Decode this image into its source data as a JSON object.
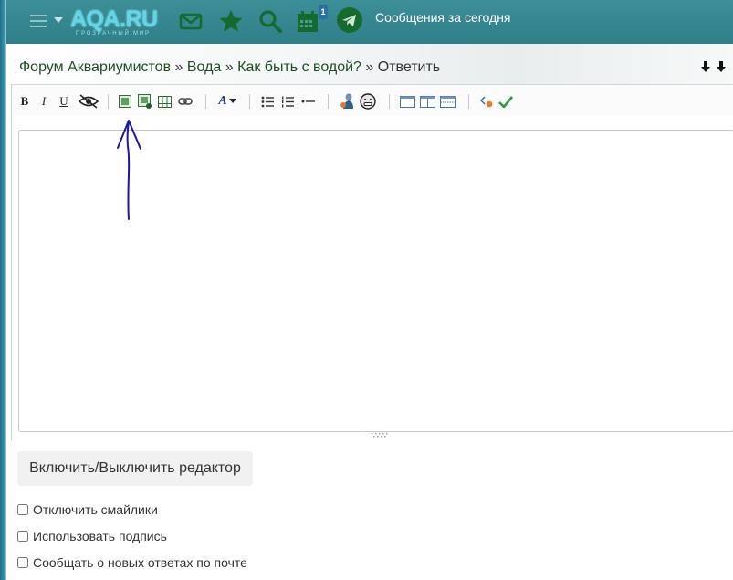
{
  "header": {
    "logo_text": "AQA.RU",
    "logo_subtitle": "прозрачный мир",
    "calendar_badge": "1",
    "today_messages": "Сообщения за сегодня",
    "icons": [
      "menu-icon",
      "mail-icon",
      "star-icon",
      "search-icon",
      "calendar-icon",
      "telegram-icon"
    ]
  },
  "breadcrumb": {
    "items": [
      "Форум Аквариумистов",
      "Вода",
      "Как быть с водой?"
    ],
    "current": "Ответить",
    "separator": "»"
  },
  "toolbar": {
    "bold": "B",
    "italic": "I",
    "underline": "U",
    "font_label": "A",
    "icons": [
      "hide-icon",
      "image-icon",
      "image-upload-icon",
      "table-icon",
      "link-icon",
      "font-icon",
      "bullet-list-icon",
      "numbered-list-icon",
      "hr-icon",
      "quote-icon",
      "smiley-icon",
      "layout-1-icon",
      "layout-2-icon",
      "layout-3-icon",
      "code-icon",
      "check-icon"
    ]
  },
  "message": {
    "value": ""
  },
  "toggle_editor_label": "Включить/Выключить редактор",
  "options": [
    {
      "label": "Отключить смайлики",
      "checked": false
    },
    {
      "label": "Использовать подпись",
      "checked": false
    },
    {
      "label": "Сообщать о новых ответах по почте",
      "checked": false
    }
  ],
  "colors": {
    "topbar": "#2f7f89",
    "icon_dark": "#176a2e",
    "link": "#1e4d24",
    "annotation_arrow": "#1a1aa0"
  }
}
